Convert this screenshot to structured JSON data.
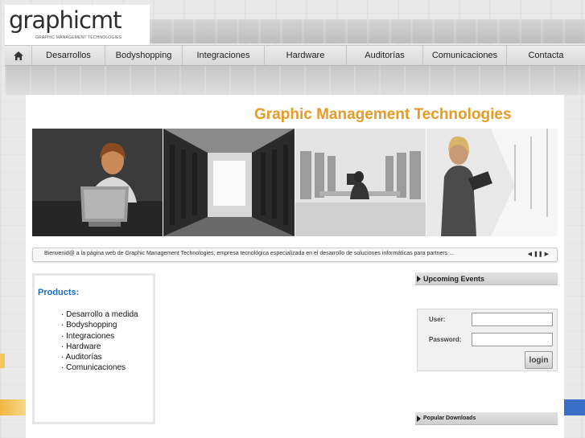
{
  "logo": {
    "name": "graphicmt",
    "tagline": "GRAPHIC MANAGEMENT TECHNOLOGIES"
  },
  "nav": {
    "home_icon": "home-icon",
    "items": [
      "Desarrollos",
      "Bodyshopping",
      "Integraciones",
      "Hardware",
      "Auditorías",
      "Comunicaciones",
      "Contacta"
    ]
  },
  "header": {
    "title": "Graphic Management Technologies"
  },
  "ticker": {
    "text": "Bienvenid@ a la página web de Graphic Management Technologies, empresa tecnológica especializada en el desarrollo de soluciones informáticas para partners ...",
    "controls": "◀ ❚❚ ▶"
  },
  "products": {
    "title": "Products:",
    "items": [
      "· Desarrollo a medida",
      "· Bodyshopping",
      "· Integraciones",
      "· Hardware",
      "· Auditorías",
      "· Comunicaciones"
    ]
  },
  "sidebar": {
    "events_title": "Upcoming Events",
    "downloads_title": "Popular Downloads"
  },
  "login": {
    "user_label": "User:",
    "password_label": "Password:",
    "user_value": "",
    "password_value": "",
    "button_label": "login"
  },
  "colors": {
    "title_orange": "#e59b26",
    "products_blue": "#1a6ec0"
  }
}
